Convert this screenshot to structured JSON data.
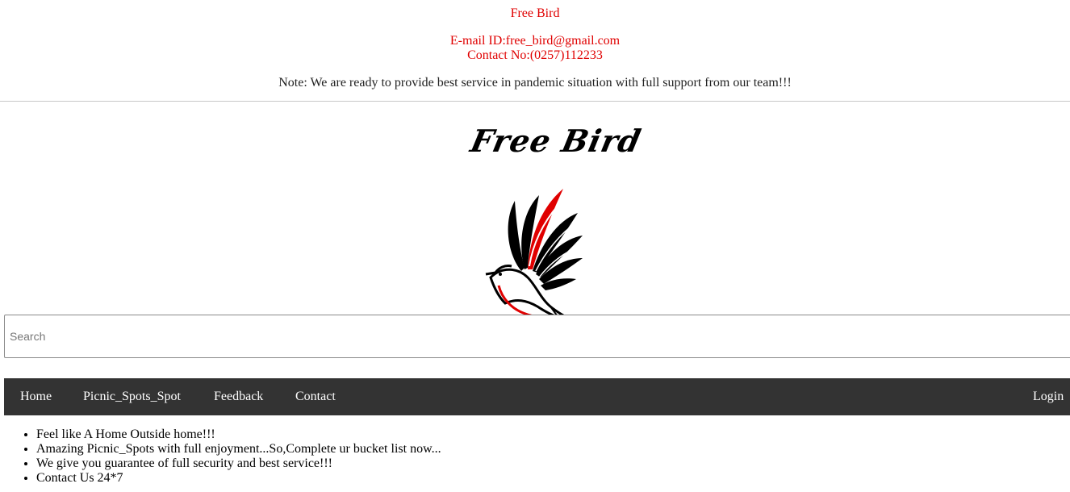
{
  "header": {
    "site_name": "Free Bird",
    "email": "E-mail ID:free_bird@gmail.com",
    "contact": "Contact No:(0257)112233",
    "note": "Note: We are ready to provide best service in pandemic situation with full support from our team!!!"
  },
  "logo": {
    "text": "Free Bird"
  },
  "search": {
    "placeholder": "Search"
  },
  "nav": {
    "items": [
      {
        "label": "Home"
      },
      {
        "label": "Picnic_Spots_Spot"
      },
      {
        "label": "Feedback"
      },
      {
        "label": "Contact"
      }
    ],
    "login_label": "Login"
  },
  "features": [
    "Feel like A Home Outside home!!!",
    "Amazing Picnic_Spots with full enjoyment...So,Complete ur bucket list now...",
    "We give you guarantee of full security and best service!!!",
    "Contact Us 24*7"
  ],
  "colors": {
    "accent_red": "#e00000",
    "navbar_bg": "#333333"
  }
}
